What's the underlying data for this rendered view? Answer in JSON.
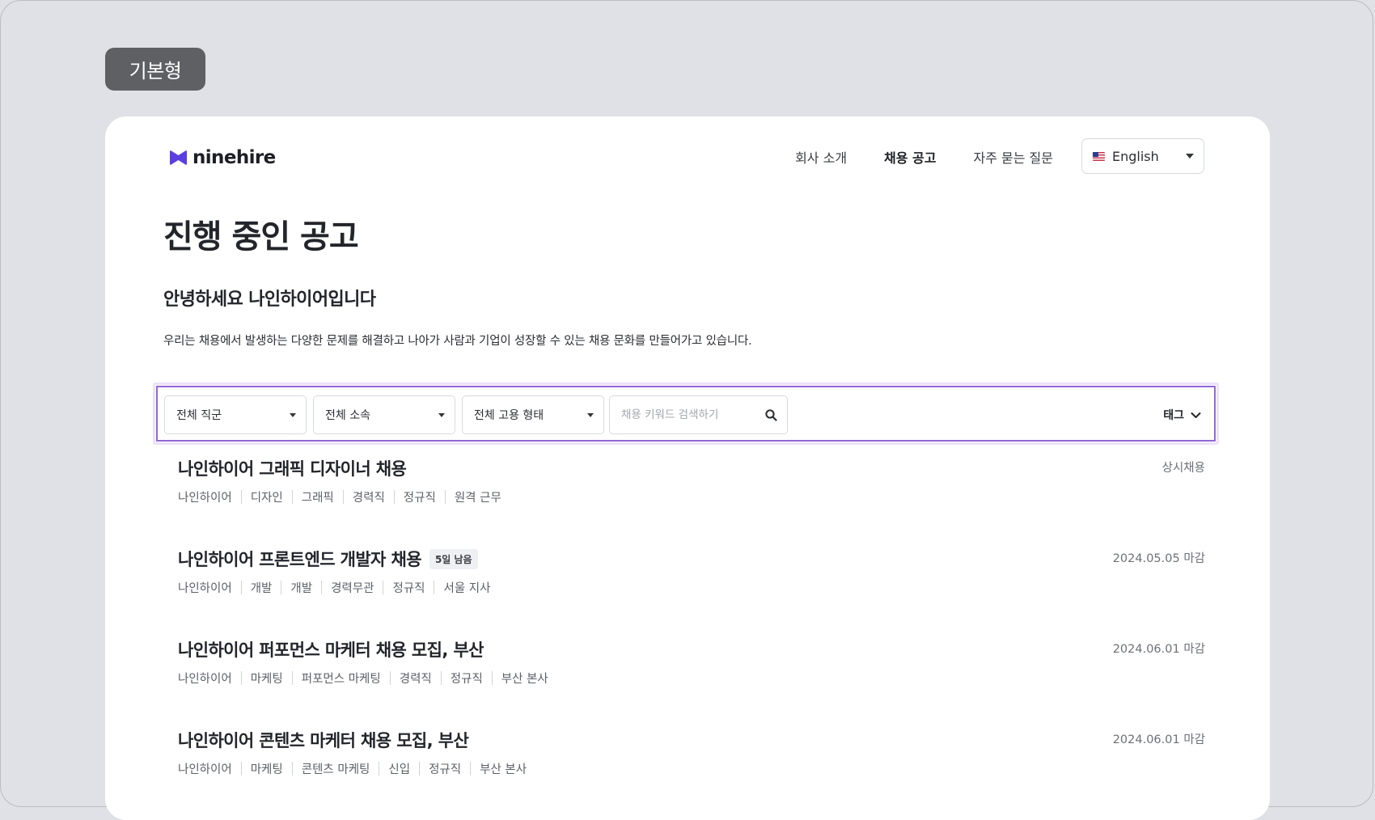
{
  "variant_label": "기본형",
  "header": {
    "logo_text": "ninehire",
    "nav": [
      "회사 소개",
      "채용 공고",
      "자주 묻는 질문"
    ],
    "nav_active_index": 1,
    "language": "English"
  },
  "page_title": "진행 중인 공고",
  "greeting": "안녕하세요 나인하이어입니다",
  "intro": "우리는 채용에서 발생하는 다양한 문제를 해결하고 나아가 사람과 기업이 성장할 수 있는 채용 문화를 만들어가고 있습니다.",
  "filters": {
    "job_group": "전체 직군",
    "affiliation": "전체 소속",
    "employment_type": "전체 고용 형태",
    "search_placeholder": "채용 키워드 검색하기",
    "tag_label": "태그"
  },
  "jobs": [
    {
      "title": "나인하이어 그래픽 디자이너 채용",
      "badge": "",
      "deadline": "상시채용",
      "tags": [
        "나인하이어",
        "디자인",
        "그래픽",
        "경력직",
        "정규직",
        "원격 근무"
      ]
    },
    {
      "title": "나인하이어 프론트엔드 개발자 채용",
      "badge": "5일 남음",
      "deadline": "2024.05.05 마감",
      "tags": [
        "나인하이어",
        "개발",
        "개발",
        "경력무관",
        "정규직",
        "서울 지사"
      ]
    },
    {
      "title": "나인하이어 퍼포먼스 마케터 채용 모집, 부산",
      "badge": "",
      "deadline": "2024.06.01 마감",
      "tags": [
        "나인하이어",
        "마케팅",
        "퍼포먼스 마케팅",
        "경력직",
        "정규직",
        "부산 본사"
      ]
    },
    {
      "title": "나인하이어 콘텐츠 마케터 채용 모집, 부산",
      "badge": "",
      "deadline": "2024.06.01 마감",
      "tags": [
        "나인하이어",
        "마케팅",
        "콘텐츠 마케팅",
        "신입",
        "정규직",
        "부산 본사"
      ]
    }
  ],
  "colors": {
    "background": "#dfe1e6",
    "card": "#ffffff",
    "badge_bg": "#5f6064",
    "logo_accent": "#5b3fe0",
    "filter_highlight": "#9167d6"
  }
}
